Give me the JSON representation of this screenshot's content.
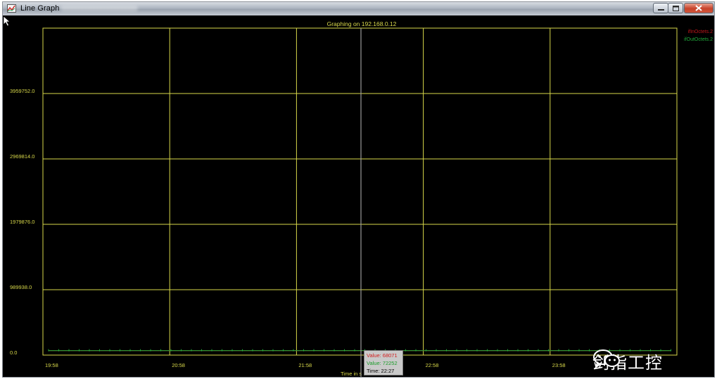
{
  "window": {
    "title": "Line Graph",
    "icon": "line-graph-icon",
    "controls": {
      "minimize": "minimize-icon",
      "maximize": "maximize-icon",
      "close": "close-icon"
    }
  },
  "colors": {
    "background": "#000000",
    "grid": "#d8d84a",
    "text": "#d8d84a",
    "series_in": "#c0171b",
    "series_out": "#1fa83a",
    "cursor_line": "#9a9a9a"
  },
  "chart_data": {
    "type": "line",
    "title": "Graphing on 192.168.0.12",
    "xlabel": "Time in s",
    "ylabel": "",
    "x_ticks": [
      "19:58",
      "20:58",
      "21:58",
      "22:58",
      "23:58"
    ],
    "y_ticks": [
      "0.0",
      "989938.0",
      "1979876.0",
      "2969814.0",
      "3959752.0"
    ],
    "ylim": [
      0,
      4949690
    ],
    "grid": true,
    "legend_placement": "top-right",
    "series": [
      {
        "name": "ifInOctets.2",
        "values": [
          68071,
          68071,
          68071,
          68071,
          68071
        ]
      },
      {
        "name": "ifOutOctets.2",
        "values": [
          72252,
          72252,
          72252,
          72252,
          72252
        ]
      }
    ]
  },
  "tooltip": {
    "value_in": "Value: 68071",
    "value_out": "Value: 72252",
    "time": "Time: 22:27"
  },
  "watermark": {
    "text": "剑指工控",
    "icon": "wechat-icon"
  }
}
